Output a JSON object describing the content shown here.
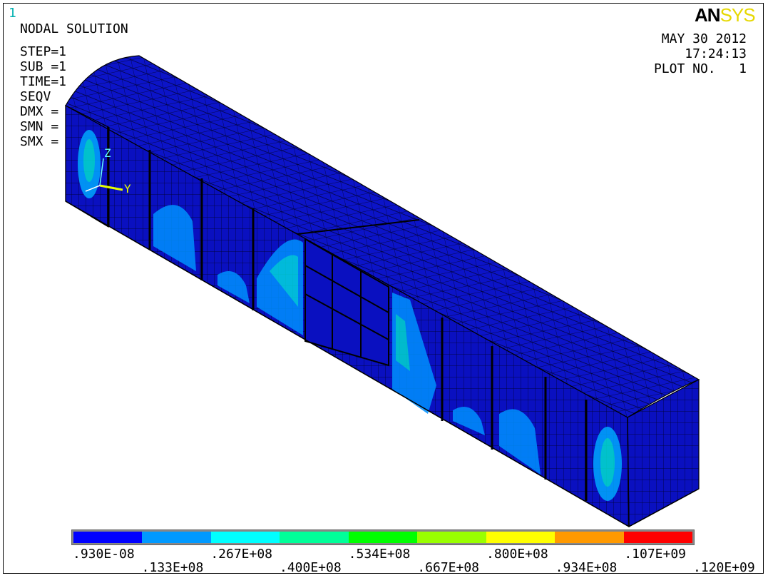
{
  "window_number": "1",
  "logo": {
    "an": "AN",
    "sys": "SYS"
  },
  "title": "NODAL SOLUTION",
  "info": [
    "STEP=1",
    "SUB =1",
    "TIME=1",
    "SEQV",
    "DMX =",
    "SMN =",
    "SMX ="
  ],
  "date": "MAY 30 2012",
  "time": "17:24:13",
  "plot_no": "PLOT NO.   1",
  "axes": {
    "z": "Z",
    "y": "Y"
  },
  "colors": {
    "bg": "#ffffff",
    "mesh_blue": "#0a10c8",
    "mesh_line": "#000030",
    "axis_yellow": "#e6ff00"
  },
  "legend": {
    "colors": [
      "#0000ff",
      "#0099ff",
      "#00ffff",
      "#00ff99",
      "#00ff00",
      "#99ff00",
      "#ffff00",
      "#ff9900",
      "#ff0000"
    ],
    "top_labels": [
      ".930E-08",
      ".267E+08",
      ".534E+08",
      ".800E+08",
      ".107E+09"
    ],
    "bottom_labels": [
      ".133E+08",
      ".400E+08",
      ".667E+08",
      ".934E+08",
      ".120E+09"
    ]
  }
}
